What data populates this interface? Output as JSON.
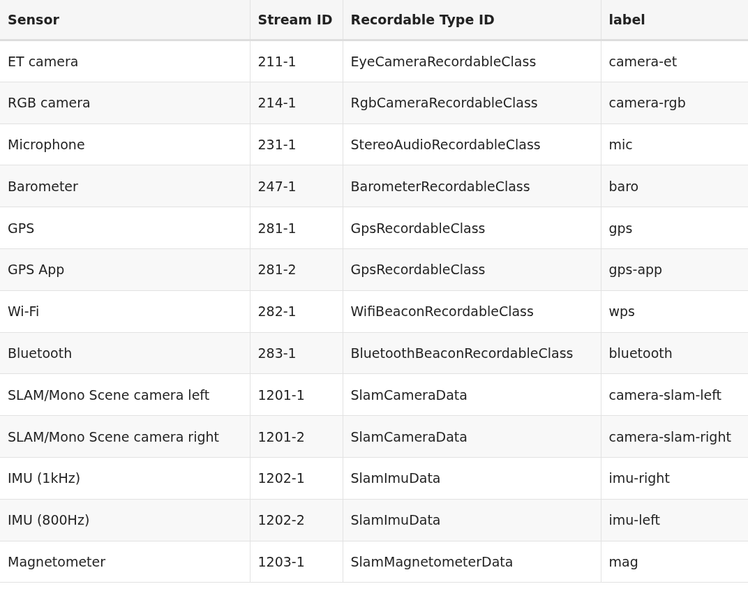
{
  "table": {
    "columns": [
      "Sensor",
      "Stream ID",
      "Recordable Type ID",
      "label"
    ],
    "rows": [
      [
        "ET camera",
        "211-1",
        "EyeCameraRecordableClass",
        "camera-et"
      ],
      [
        "RGB camera",
        "214-1",
        "RgbCameraRecordableClass",
        "camera-rgb"
      ],
      [
        "Microphone",
        "231-1",
        "StereoAudioRecordableClass",
        "mic"
      ],
      [
        "Barometer",
        "247-1",
        "BarometerRecordableClass",
        "baro"
      ],
      [
        "GPS",
        "281-1",
        "GpsRecordableClass",
        "gps"
      ],
      [
        "GPS App",
        "281-2",
        "GpsRecordableClass",
        "gps-app"
      ],
      [
        "Wi-Fi",
        "282-1",
        "WifiBeaconRecordableClass",
        "wps"
      ],
      [
        "Bluetooth",
        "283-1",
        "BluetoothBeaconRecordableClass",
        "bluetooth"
      ],
      [
        "SLAM/Mono Scene camera left",
        "1201-1",
        "SlamCameraData",
        "camera-slam-left"
      ],
      [
        "SLAM/Mono Scene camera right",
        "1201-2",
        "SlamCameraData",
        "camera-slam-right"
      ],
      [
        "IMU (1kHz)",
        "1202-1",
        "SlamImuData",
        "imu-right"
      ],
      [
        "IMU (800Hz)",
        "1202-2",
        "SlamImuData",
        "imu-left"
      ],
      [
        "Magnetometer",
        "1203-1",
        "SlamMagnetometerData",
        "mag"
      ]
    ]
  }
}
